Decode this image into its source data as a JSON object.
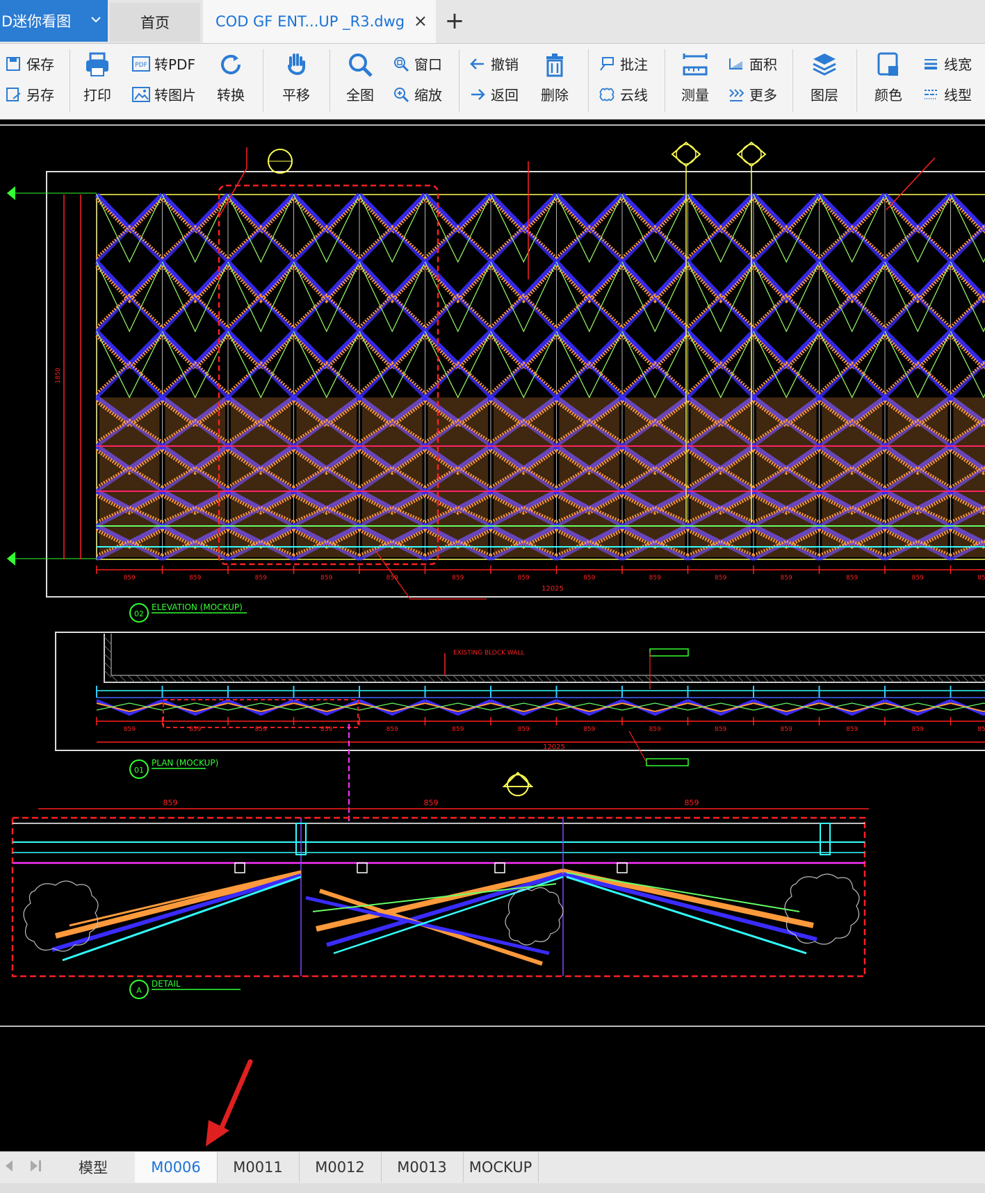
{
  "app": {
    "title_fragment": "D迷你看图"
  },
  "tabs": {
    "home": "首页",
    "file": "COD GF ENT...UP _R3.dwg",
    "close": "×",
    "new": "+"
  },
  "toolbar": {
    "save": "保存",
    "save_as": "另存",
    "print": "打印",
    "to_pdf": "转PDF",
    "to_image": "转图片",
    "convert": "转换",
    "pan": "平移",
    "full_view": "全图",
    "window": "窗口",
    "zoom": "缩放",
    "undo": "撤销",
    "back": "返回",
    "delete": "删除",
    "annotate": "批注",
    "cloud_line": "云线",
    "measure": "测量",
    "area": "面积",
    "more": "更多",
    "layers": "图层",
    "color": "颜色",
    "line_width": "线宽",
    "line_type": "线型"
  },
  "drawing": {
    "elevation_label": "ELEVATION (MOCKUP)",
    "plan_label": "PLAN (MOCKUP)",
    "detail_label": "DETAIL",
    "elevation_no": "02",
    "plan_no": "01",
    "detail_no": "A",
    "module_width": "859",
    "total_width": "12025",
    "detail_overall_width": "859",
    "existing_wall_note": "EXISTING BLOCK WALL",
    "height_dim": "1850"
  },
  "sheets": {
    "tabs": [
      "模型",
      "M0006",
      "M0011",
      "M0012",
      "M0013",
      "MOCKUP"
    ],
    "active": "M0006"
  },
  "colors": {
    "accent": "#2b7cd3",
    "active_tab_text": "#1a73d8",
    "canvas_bg": "#000000",
    "panel_orange": "#ff9a3c",
    "panel_blue": "#3a2cff",
    "dim_red": "#ff2020",
    "green": "#33ff33",
    "yellow": "#ffff55",
    "annotation_arrow": "#e02020"
  }
}
